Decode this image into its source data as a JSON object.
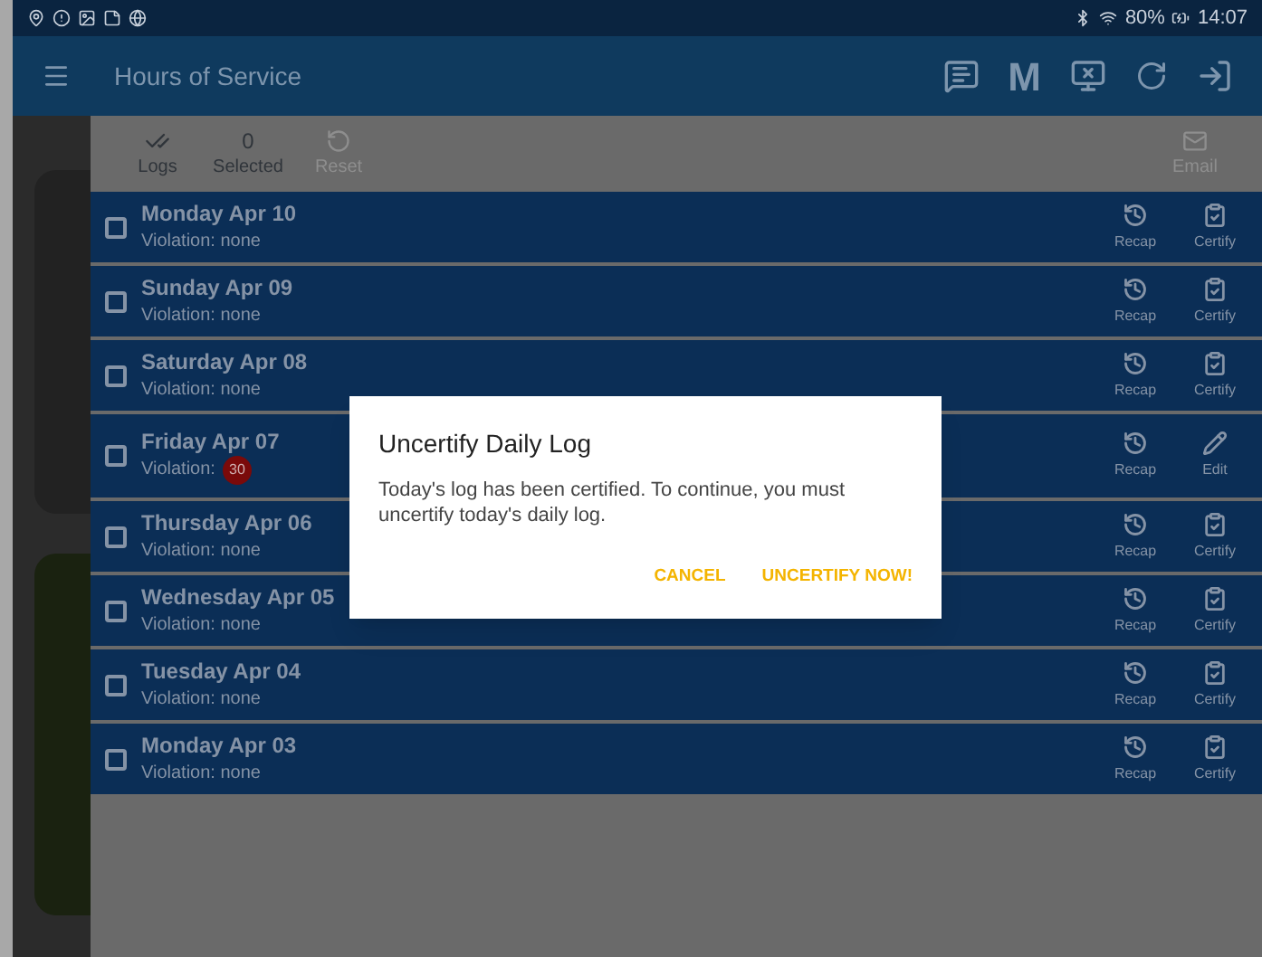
{
  "status_bar": {
    "battery": "80%",
    "time": "14:07"
  },
  "app_bar": {
    "title": "Hours of Service",
    "actions": [
      "M"
    ]
  },
  "toolbar": [
    {
      "kind": "logs",
      "label": "Logs",
      "disabled": false
    },
    {
      "kind": "count",
      "value": "0",
      "label": "Selected",
      "disabled": false
    },
    {
      "kind": "reset",
      "label": "Reset",
      "disabled": true
    },
    {
      "kind": "email",
      "label": "Email",
      "disabled": true
    }
  ],
  "logs": [
    {
      "title": "Monday Apr 10",
      "violation": "Violation: none",
      "checked": false,
      "actions": [
        {
          "kind": "recap",
          "label": "Recap"
        },
        {
          "kind": "certify",
          "label": "Certify"
        }
      ]
    },
    {
      "title": "Sunday Apr 09",
      "violation": "Violation: none",
      "checked": false,
      "actions": [
        {
          "kind": "recap",
          "label": "Recap"
        },
        {
          "kind": "certify",
          "label": "Certify"
        }
      ]
    },
    {
      "title": "Saturday Apr 08",
      "violation": "Violation: none",
      "checked": false,
      "actions": [
        {
          "kind": "recap",
          "label": "Recap"
        },
        {
          "kind": "certify",
          "label": "Certify"
        }
      ]
    },
    {
      "title": "Friday Apr 07",
      "violation": "Violation:",
      "badge": "30",
      "checked": false,
      "actions": [
        {
          "kind": "recap",
          "label": "Recap"
        },
        {
          "kind": "edit",
          "label": "Edit"
        }
      ]
    },
    {
      "title": "Thursday Apr 06",
      "violation": "Violation: none",
      "checked": false,
      "actions": [
        {
          "kind": "recap",
          "label": "Recap"
        },
        {
          "kind": "certify",
          "label": "Certify"
        }
      ]
    },
    {
      "title": "Wednesday Apr 05",
      "violation": "Violation: none",
      "checked": false,
      "actions": [
        {
          "kind": "recap",
          "label": "Recap"
        },
        {
          "kind": "certify",
          "label": "Certify"
        }
      ]
    },
    {
      "title": "Tuesday Apr 04",
      "violation": "Violation: none",
      "checked": false,
      "actions": [
        {
          "kind": "recap",
          "label": "Recap"
        },
        {
          "kind": "certify",
          "label": "Certify"
        }
      ]
    },
    {
      "title": "Monday Apr 03",
      "violation": "Violation: none",
      "checked": false,
      "actions": [
        {
          "kind": "recap",
          "label": "Recap"
        },
        {
          "kind": "certify",
          "label": "Certify"
        }
      ]
    }
  ],
  "dialog": {
    "title": "Uncertify Daily Log",
    "message": "Today's log has been certified. To continue, you must uncertify today's daily log.",
    "buttons": [
      "CANCEL",
      "UNCERTIFY NOW!"
    ]
  }
}
